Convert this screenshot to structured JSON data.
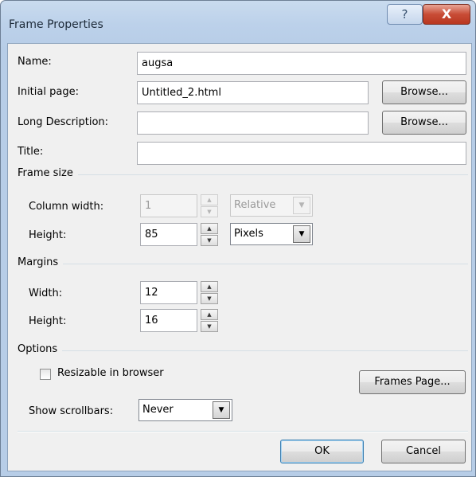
{
  "window": {
    "title": "Frame Properties",
    "help_glyph": "?",
    "close_glyph": "X"
  },
  "fields": {
    "name": {
      "label": "Name:",
      "value": "augsa"
    },
    "initial_page": {
      "label": "Initial page:",
      "value": "Untitled_2.html",
      "browse_label": "Browse..."
    },
    "long_description": {
      "label": "Long Description:",
      "value": "",
      "browse_label": "Browse..."
    },
    "title": {
      "label": "Title:",
      "value": ""
    }
  },
  "frame_size": {
    "group_label": "Frame size",
    "column_width": {
      "label": "Column width:",
      "value": "1",
      "unit": "Relative",
      "enabled": false
    },
    "height": {
      "label": "Height:",
      "value": "85",
      "unit": "Pixels"
    }
  },
  "margins": {
    "group_label": "Margins",
    "width": {
      "label": "Width:",
      "value": "12"
    },
    "height": {
      "label": "Height:",
      "value": "16"
    }
  },
  "options": {
    "group_label": "Options",
    "resizable": {
      "label": "Resizable in browser",
      "checked": false
    },
    "frames_page_label": "Frames Page...",
    "show_scrollbars": {
      "label": "Show scrollbars:",
      "value": "Never"
    }
  },
  "footer": {
    "ok_label": "OK",
    "cancel_label": "Cancel"
  },
  "icons": {
    "spin_up": "▲",
    "spin_down": "▼",
    "dropdown": "▼"
  },
  "colors": {
    "title_bar": "#bcd1ea",
    "close_button": "#c84c36",
    "dialog_body": "#f0f0f0"
  }
}
